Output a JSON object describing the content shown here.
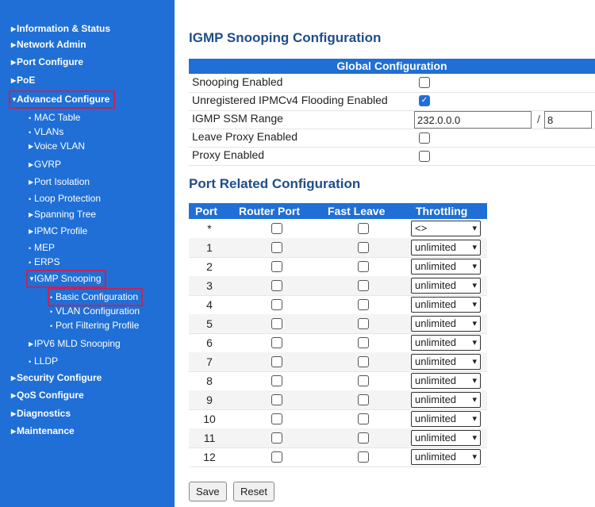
{
  "sidebar": {
    "info_status": "Information & Status",
    "network_admin": "Network Admin",
    "port_configure": "Port Configure",
    "poe": "PoE",
    "advanced_configure": "Advanced Configure",
    "mac_table": "MAC Table",
    "vlans": "VLANs",
    "voice_vlan": "Voice VLAN",
    "gvrp": "GVRP",
    "port_isolation": "Port Isolation",
    "loop_protection": "Loop Protection",
    "spanning_tree": "Spanning Tree",
    "ipmc_profile": "IPMC Profile",
    "mep": "MEP",
    "erps": "ERPS",
    "igmp_snooping": "IGMP Snooping",
    "basic_configuration": "Basic Configuration",
    "vlan_configuration": "VLAN Configuration",
    "port_filtering_profile": "Port Filtering Profile",
    "ipv6_mld_snooping": "IPV6 MLD Snooping",
    "lldp": "LLDP",
    "security_configure": "Security Configure",
    "qos_configure": "QoS Configure",
    "diagnostics": "Diagnostics",
    "maintenance": "Maintenance"
  },
  "main": {
    "page_title": "IGMP Snooping Configuration",
    "global": {
      "header": "Global Configuration",
      "snooping_enabled_label": "Snooping Enabled",
      "snooping_enabled": false,
      "flooding_label": "Unregistered IPMCv4 Flooding Enabled",
      "flooding_enabled": true,
      "ssm_label": "IGMP SSM Range",
      "ssm_address": "232.0.0.0",
      "ssm_separator": "/",
      "ssm_prefix": "8",
      "leave_proxy_label": "Leave Proxy Enabled",
      "leave_proxy_enabled": false,
      "proxy_label": "Proxy Enabled",
      "proxy_enabled": false
    },
    "port_section_title": "Port Related Configuration",
    "port_table": {
      "headers": {
        "port": "Port",
        "router_port": "Router Port",
        "fast_leave": "Fast Leave",
        "throttling": "Throttling"
      },
      "rows": [
        {
          "port": "*",
          "throttling": "<>"
        },
        {
          "port": "1",
          "throttling": "unlimited"
        },
        {
          "port": "2",
          "throttling": "unlimited"
        },
        {
          "port": "3",
          "throttling": "unlimited"
        },
        {
          "port": "4",
          "throttling": "unlimited"
        },
        {
          "port": "5",
          "throttling": "unlimited"
        },
        {
          "port": "6",
          "throttling": "unlimited"
        },
        {
          "port": "7",
          "throttling": "unlimited"
        },
        {
          "port": "8",
          "throttling": "unlimited"
        },
        {
          "port": "9",
          "throttling": "unlimited"
        },
        {
          "port": "10",
          "throttling": "unlimited"
        },
        {
          "port": "11",
          "throttling": "unlimited"
        },
        {
          "port": "12",
          "throttling": "unlimited"
        }
      ]
    },
    "buttons": {
      "save": "Save",
      "reset": "Reset"
    }
  },
  "colors": {
    "sidebar_bg": "#1f6fd6",
    "title": "#1f4d8c",
    "highlight": "#c0265a"
  },
  "icons": {
    "collapsed": "triangle-right-icon",
    "expanded": "triangle-down-icon",
    "leaf": "bullet-icon",
    "dropdown": "chevron-down-icon",
    "checked": "checkmark-icon"
  }
}
